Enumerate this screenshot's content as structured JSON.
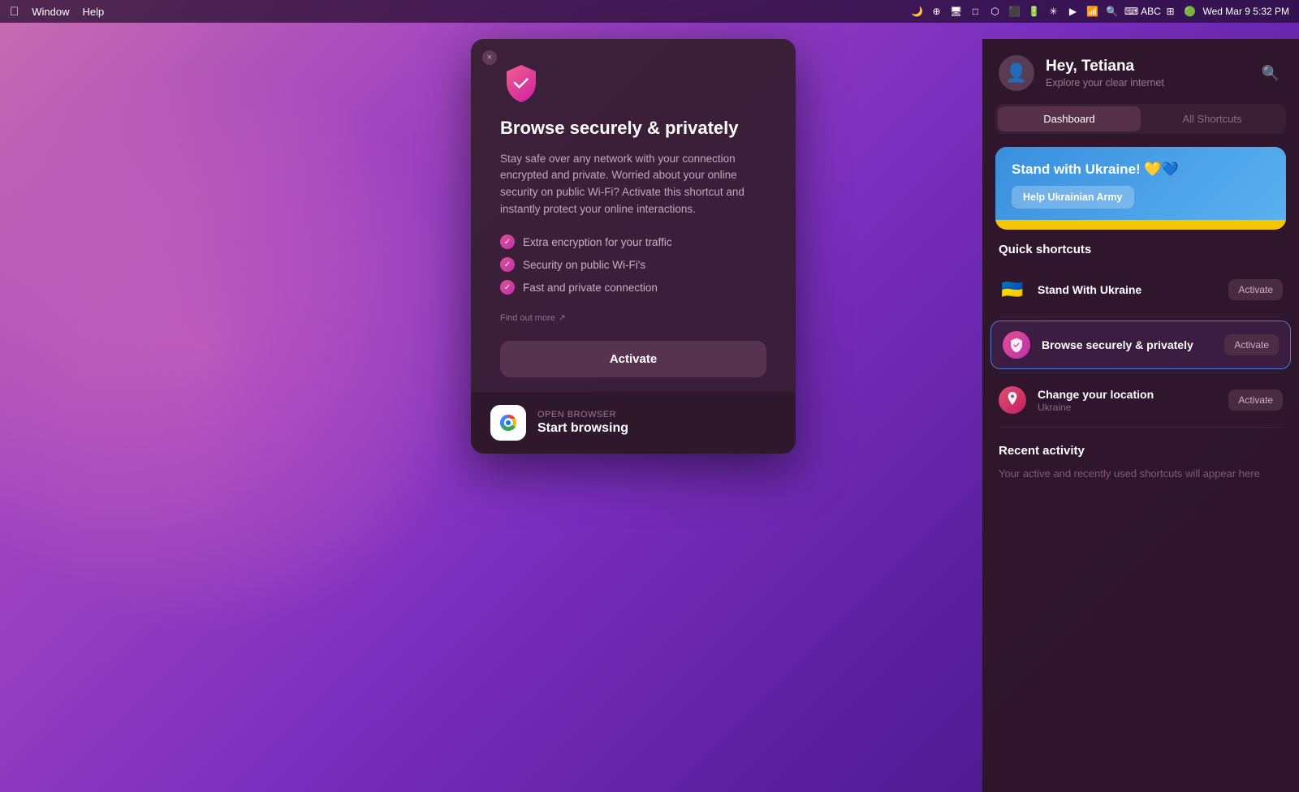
{
  "menubar": {
    "apple": "🍎",
    "app": "Window",
    "help": "Help",
    "time": "Wed Mar 9  5:32 PM"
  },
  "modal": {
    "close_label": "×",
    "title": "Browse securely & privately",
    "description": "Stay safe over any network with your connection encrypted and private. Worried about your online security on public Wi-Fi? Activate this shortcut and instantly protect your online interactions.",
    "features": [
      "Extra encryption for your traffic",
      "Security on public Wi-Fi's",
      "Fast and private connection"
    ],
    "find_out_more": "Find out more",
    "activate_label": "Activate",
    "footer": {
      "label": "OPEN BROWSER",
      "action": "Start browsing"
    }
  },
  "panel": {
    "greeting": "Hey, Tetiana",
    "subtitle": "Explore your clear internet",
    "tabs": [
      {
        "label": "Dashboard",
        "active": true
      },
      {
        "label": "All Shortcuts",
        "active": false
      }
    ],
    "ukraine_banner": {
      "title": "Stand with Ukraine! 💛💙",
      "button": "Help Ukrainian Army"
    },
    "quick_shortcuts_title": "Quick shortcuts",
    "shortcuts": [
      {
        "name": "Stand With Ukraine",
        "sub": "",
        "activate": "Activate",
        "selected": false
      },
      {
        "name": "Browse securely & privately",
        "sub": "",
        "activate": "Activate",
        "selected": true
      },
      {
        "name": "Change your location",
        "sub": "Ukraine",
        "activate": "Activate",
        "selected": false
      }
    ],
    "recent_activity_title": "Recent activity",
    "recent_activity_text": "Your active and recently used shortcuts will appear here"
  }
}
